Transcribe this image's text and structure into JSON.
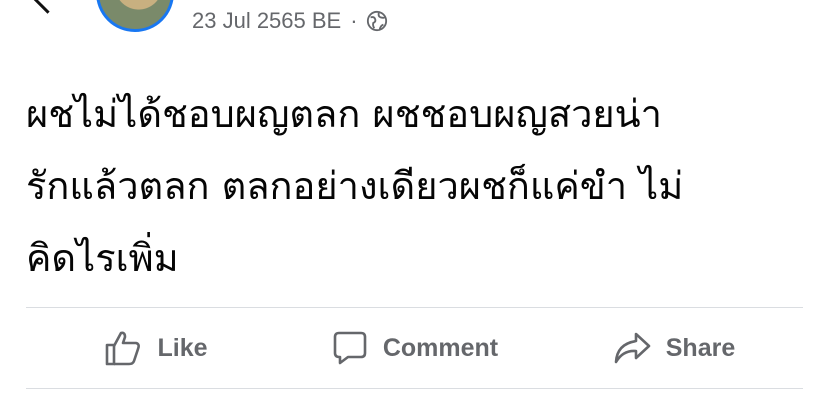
{
  "post": {
    "timestamp": "23 Jul 2565 BE",
    "separator": "·",
    "privacy_icon": "globe-icon",
    "text_lines": [
      "ผชไม่ได้ชอบผญตลก ผชชอบผญสวยน่า",
      "รักแล้วตลก ตลกอย่างเดียวผชก็แค่ขำ ไม่",
      "คิดไรเพิ่ม"
    ]
  },
  "actions": [
    {
      "label": "Like",
      "icon": "thumbs-up-icon"
    },
    {
      "label": "Comment",
      "icon": "comment-icon"
    },
    {
      "label": "Share",
      "icon": "share-icon"
    }
  ],
  "colors": {
    "accent": "#1877f2",
    "secondary_text": "#65676b",
    "divider": "#dadde1"
  }
}
